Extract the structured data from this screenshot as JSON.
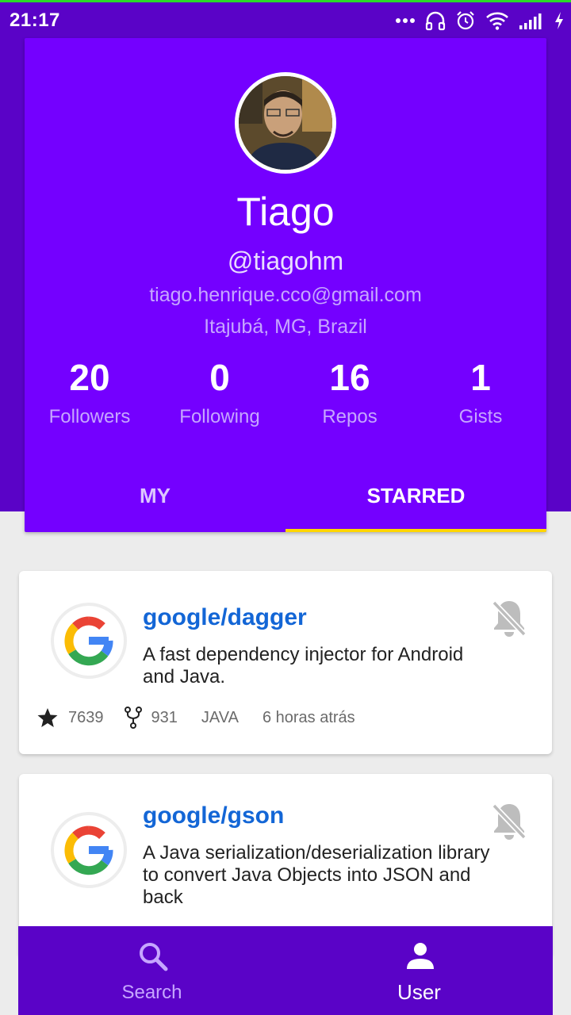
{
  "status_bar": {
    "time": "21:17",
    "icons": [
      "more-dots-icon",
      "headset-icon",
      "alarm-icon",
      "wifi-icon",
      "signal-icon",
      "charging-icon"
    ]
  },
  "profile": {
    "name": "Tiago",
    "login": "@tiagohm",
    "email": "tiago.henrique.cco@gmail.com",
    "location": "Itajubá, MG, Brazil",
    "stats": [
      {
        "value": "20",
        "label": "Followers"
      },
      {
        "value": "0",
        "label": "Following"
      },
      {
        "value": "16",
        "label": "Repos"
      },
      {
        "value": "1",
        "label": "Gists"
      }
    ]
  },
  "tabs": {
    "my": "MY",
    "starred": "STARRED",
    "selected": "starred"
  },
  "repos": [
    {
      "name": "google/dagger",
      "description": "A fast dependency injector for Android and Java.",
      "stars": "7639",
      "forks": "931",
      "language": "JAVA",
      "updated": "6 horas atrás"
    },
    {
      "name": "google/gson",
      "description": "A Java serialization/deserialization library to convert Java Objects into JSON and back"
    }
  ],
  "bottom_nav": {
    "search": "Search",
    "user": "User",
    "selected": "user"
  },
  "colors": {
    "primary_dark": "#5a03c7",
    "primary": "#7400ff",
    "accent": "#ffd600",
    "repo_link": "#1366d6"
  }
}
